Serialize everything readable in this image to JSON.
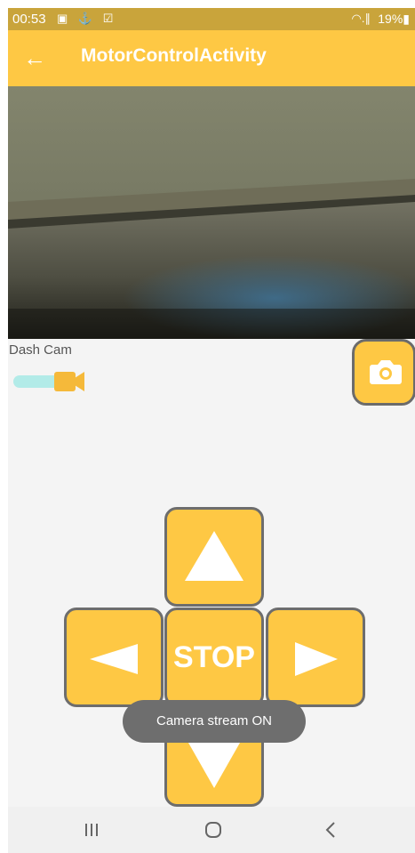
{
  "status_bar": {
    "time": "00:53",
    "notification_icons": "▣ ⚓ ☑",
    "signal": "◠.∥",
    "battery": "19%▮"
  },
  "app_bar": {
    "back_icon": "←",
    "title": "MotorControlActivity"
  },
  "camera": {
    "label": "Dash Cam",
    "toggle_on": true
  },
  "controls": {
    "stop_label": "STOP"
  },
  "toast": {
    "message": "Camera stream ON"
  },
  "colors": {
    "accent": "#fec844",
    "status_bar": "#c9a43b",
    "toggle_track": "#b2ebe8",
    "button_border": "#6d6d6d"
  }
}
